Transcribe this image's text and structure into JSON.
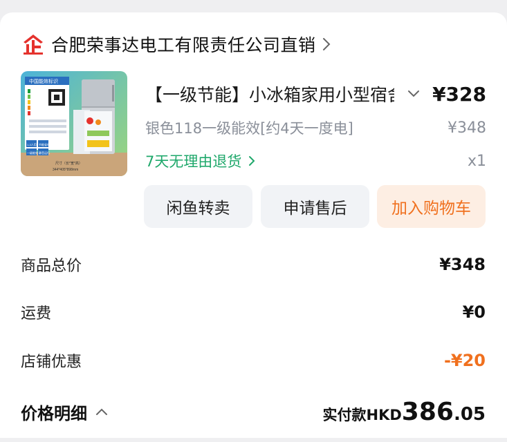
{
  "shop": {
    "name": "合肥荣事达电工有限责任公司直销",
    "logo_icon": "shop-logo-icon",
    "chevron_icon": "chevron-right-icon"
  },
  "item": {
    "image_icon": "refrigerator-product-image",
    "image_texts": {
      "energy_label": "中国能效标识",
      "feature_1": "1-3人用",
      "feature_2": "节能省电",
      "feature_3": "一级能效",
      "feature_4": "静音运行",
      "size_title": "尺寸（长*宽*高）",
      "size_value": "344*405*898mm"
    },
    "title": "【一级节能】小冰箱家用小型宿舍",
    "price": "¥328",
    "spec": "银色118一级能效[约4天一度电]",
    "original_price": "¥348",
    "return_policy": "7天无理由退货",
    "quantity": "x1"
  },
  "actions": {
    "xianyu": "闲鱼转卖",
    "after_sales": "申请售后",
    "add_to_cart": "加入购物车"
  },
  "summary": {
    "goods_total_label": "商品总价",
    "goods_total_value": "¥348",
    "shipping_label": "运费",
    "shipping_value": "¥0",
    "shop_discount_label": "店铺优惠",
    "shop_discount_value": "-¥20"
  },
  "footer": {
    "detail_label": "价格明细",
    "paid_label": "实付款HKD",
    "paid_int": "386",
    "paid_dec": ".05"
  },
  "colors": {
    "accent_orange": "#f0701e",
    "green": "#1fa86b",
    "logo_red": "#e5322d"
  }
}
